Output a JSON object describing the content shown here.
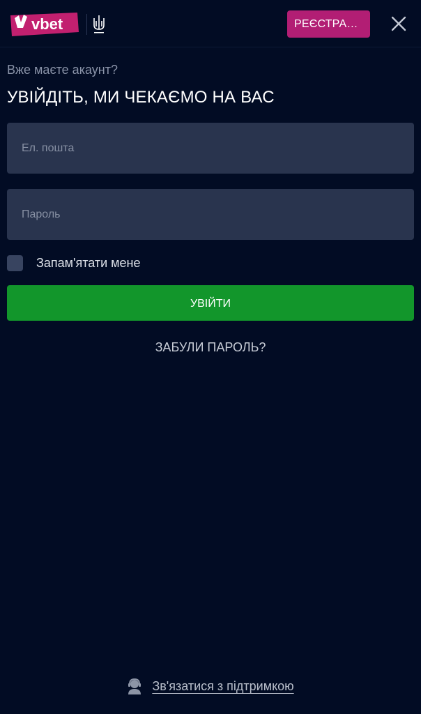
{
  "header": {
    "logo_text": "vbet",
    "register_label": "РЕЄСТРАЦІЯ",
    "close_icon": "close-icon",
    "emblem_icon": "trident-emblem-icon",
    "colors": {
      "brand": "#b21e74",
      "background": "#020c24"
    }
  },
  "login": {
    "subtitle": "Вже маєте акаунт?",
    "title": "УВІЙДІТЬ, МИ ЧЕКАЄМО НА ВАС",
    "email_placeholder": "Ел. пошта",
    "email_value": "",
    "password_placeholder": "Пароль",
    "password_value": "",
    "remember_label": "Запам'ятати мене",
    "submit_label": "УВІЙТИ",
    "forgot_label": "ЗАБУЛИ ПАРОЛЬ?",
    "colors": {
      "submit": "#12962b",
      "input_bg": "#29344e"
    }
  },
  "footer": {
    "support_label": "Зв'язатися з підтримкою",
    "support_icon": "support-agent-icon"
  }
}
